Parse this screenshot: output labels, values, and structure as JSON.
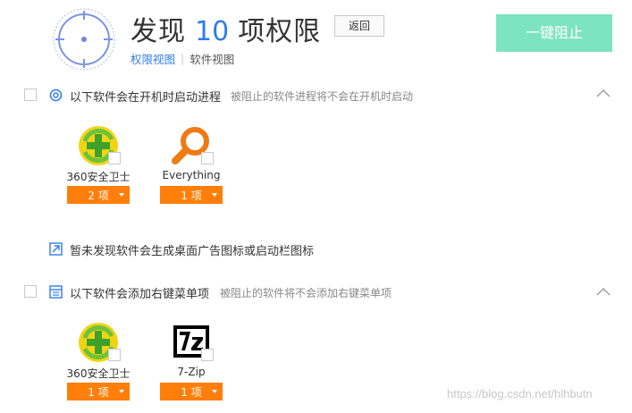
{
  "header": {
    "title_prefix": "发现",
    "count": "10",
    "title_suffix": "项权限",
    "back_label": "返回",
    "block_all_label": "一键阻止",
    "tabs": [
      {
        "label": "权限视图",
        "active": true
      },
      {
        "label": "软件视图",
        "active": false
      }
    ]
  },
  "sections": [
    {
      "id": "startup",
      "title": "以下软件会在开机时启动进程",
      "desc": "被阻止的软件进程将不会在开机时启动",
      "collapsible": true,
      "icon": "power-icon",
      "apps": [
        {
          "name": "360安全卫士",
          "count_label": "2 项",
          "icon": "360-icon"
        },
        {
          "name": "Everything",
          "count_label": "1 项",
          "icon": "everything-icon"
        }
      ]
    },
    {
      "id": "desktop_ads",
      "title": "暂未发现软件会生成桌面广告图标或启动栏图标",
      "icon": "desktop-icon"
    },
    {
      "id": "context_menu",
      "title": "以下软件会添加右键菜单项",
      "desc": "被阻止的软件将不会添加右键菜单项",
      "collapsible": true,
      "icon": "menu-icon",
      "apps": [
        {
          "name": "360安全卫士",
          "count_label": "1 项",
          "icon": "360-icon"
        },
        {
          "name": "7-Zip",
          "count_label": "1 项",
          "icon": "7zip-icon"
        }
      ]
    }
  ],
  "watermark": "https://blog.csdn.net/hlhbutn",
  "colors": {
    "accent_blue": "#2f7ce6",
    "block_button": "#7de3c0",
    "dropdown_orange": "#ff7f0a"
  }
}
